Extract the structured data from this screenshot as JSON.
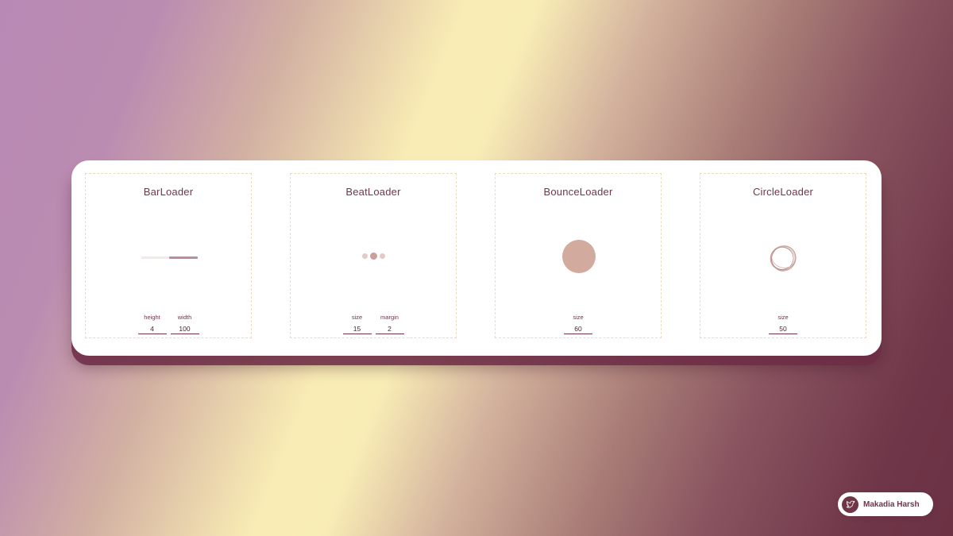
{
  "loaders": [
    {
      "title": "BarLoader",
      "controls": [
        {
          "label": "height",
          "value": "4"
        },
        {
          "label": "width",
          "value": "100"
        }
      ]
    },
    {
      "title": "BeatLoader",
      "controls": [
        {
          "label": "size",
          "value": "15"
        },
        {
          "label": "margin",
          "value": "2"
        }
      ]
    },
    {
      "title": "BounceLoader",
      "controls": [
        {
          "label": "size",
          "value": "60"
        }
      ]
    },
    {
      "title": "CircleLoader",
      "controls": [
        {
          "label": "size",
          "value": "50"
        }
      ]
    }
  ],
  "credit": {
    "name": "Makadia Harsh",
    "icon": "twitter-bird-icon"
  },
  "colors": {
    "accent": "#6f3646",
    "loader": "#c9a09a",
    "bar": "#b98c9e"
  }
}
